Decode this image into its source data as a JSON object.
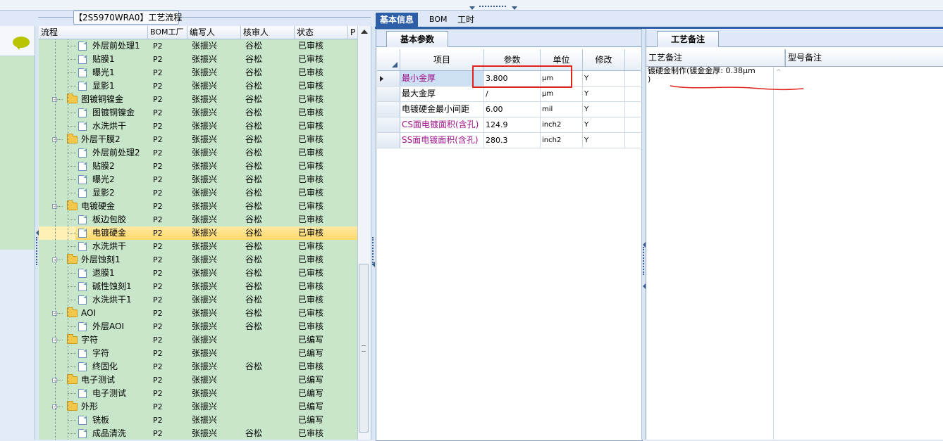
{
  "process_panel": {
    "caption": "【2S5970WRA0】工艺流程",
    "columns": [
      "流程",
      "BOM工厂",
      "编写人",
      "核审人",
      "状态",
      "P"
    ],
    "rows": [
      {
        "name": "外层前处理1",
        "level": 2,
        "type": "doc",
        "bom": "P2",
        "writer": "张振兴",
        "reviewer": "谷松",
        "status": "已审核"
      },
      {
        "name": "贴膜1",
        "level": 2,
        "type": "doc",
        "bom": "P2",
        "writer": "张振兴",
        "reviewer": "谷松",
        "status": "已审核"
      },
      {
        "name": "曝光1",
        "level": 2,
        "type": "doc",
        "bom": "P2",
        "writer": "张振兴",
        "reviewer": "谷松",
        "status": "已审核"
      },
      {
        "name": "显影1",
        "level": 2,
        "type": "doc",
        "bom": "P2",
        "writer": "张振兴",
        "reviewer": "谷松",
        "status": "已审核"
      },
      {
        "name": "图镀铜镍金",
        "level": 1,
        "type": "folder",
        "bom": "P2",
        "writer": "张振兴",
        "reviewer": "谷松",
        "status": "已审核"
      },
      {
        "name": "图镀铜镍金",
        "level": 2,
        "type": "doc",
        "bom": "P2",
        "writer": "张振兴",
        "reviewer": "谷松",
        "status": "已审核"
      },
      {
        "name": "水洗烘干",
        "level": 2,
        "type": "doc",
        "bom": "P2",
        "writer": "张振兴",
        "reviewer": "谷松",
        "status": "已审核"
      },
      {
        "name": "外层干膜2",
        "level": 1,
        "type": "folder",
        "bom": "P2",
        "writer": "张振兴",
        "reviewer": "谷松",
        "status": "已审核"
      },
      {
        "name": "外层前处理2",
        "level": 2,
        "type": "doc",
        "bom": "P2",
        "writer": "张振兴",
        "reviewer": "谷松",
        "status": "已审核"
      },
      {
        "name": "贴膜2",
        "level": 2,
        "type": "doc",
        "bom": "P2",
        "writer": "张振兴",
        "reviewer": "谷松",
        "status": "已审核"
      },
      {
        "name": "曝光2",
        "level": 2,
        "type": "doc",
        "bom": "P2",
        "writer": "张振兴",
        "reviewer": "谷松",
        "status": "已审核"
      },
      {
        "name": "显影2",
        "level": 2,
        "type": "doc",
        "bom": "P2",
        "writer": "张振兴",
        "reviewer": "谷松",
        "status": "已审核"
      },
      {
        "name": "电镀硬金",
        "level": 1,
        "type": "folder",
        "bom": "P2",
        "writer": "张振兴",
        "reviewer": "谷松",
        "status": "已审核"
      },
      {
        "name": "板边包胶",
        "level": 2,
        "type": "doc",
        "bom": "P2",
        "writer": "张振兴",
        "reviewer": "谷松",
        "status": "已审核"
      },
      {
        "name": "电镀硬金",
        "level": 2,
        "type": "doc",
        "bom": "P2",
        "writer": "张振兴",
        "reviewer": "谷松",
        "status": "已审核",
        "selected": true
      },
      {
        "name": "水洗烘干",
        "level": 2,
        "type": "doc",
        "bom": "P2",
        "writer": "张振兴",
        "reviewer": "谷松",
        "status": "已审核"
      },
      {
        "name": "外层蚀刻1",
        "level": 1,
        "type": "folder",
        "bom": "P2",
        "writer": "张振兴",
        "reviewer": "谷松",
        "status": "已审核"
      },
      {
        "name": "退膜1",
        "level": 2,
        "type": "doc",
        "bom": "P2",
        "writer": "张振兴",
        "reviewer": "谷松",
        "status": "已审核"
      },
      {
        "name": "碱性蚀刻1",
        "level": 2,
        "type": "doc",
        "bom": "P2",
        "writer": "张振兴",
        "reviewer": "谷松",
        "status": "已审核"
      },
      {
        "name": "水洗烘干1",
        "level": 2,
        "type": "doc",
        "bom": "P2",
        "writer": "张振兴",
        "reviewer": "谷松",
        "status": "已审核"
      },
      {
        "name": "AOI",
        "level": 1,
        "type": "folder",
        "bom": "P2",
        "writer": "张振兴",
        "reviewer": "谷松",
        "status": "已审核"
      },
      {
        "name": "外层AOI",
        "level": 2,
        "type": "doc",
        "bom": "P2",
        "writer": "张振兴",
        "reviewer": "谷松",
        "status": "已审核"
      },
      {
        "name": "字符",
        "level": 1,
        "type": "folder",
        "bom": "P2",
        "writer": "张振兴",
        "reviewer": "",
        "status": "已编写"
      },
      {
        "name": "字符",
        "level": 2,
        "type": "doc",
        "bom": "P2",
        "writer": "张振兴",
        "reviewer": "",
        "status": "已编写"
      },
      {
        "name": "终固化",
        "level": 2,
        "type": "doc",
        "bom": "P2",
        "writer": "张振兴",
        "reviewer": "谷松",
        "status": "已审核"
      },
      {
        "name": "电子测试",
        "level": 1,
        "type": "folder",
        "bom": "P2",
        "writer": "张振兴",
        "reviewer": "",
        "status": "已编写"
      },
      {
        "name": "电子测试",
        "level": 2,
        "type": "doc",
        "bom": "P2",
        "writer": "张振兴",
        "reviewer": "",
        "status": "已编写"
      },
      {
        "name": "外形",
        "level": 1,
        "type": "folder",
        "bom": "P2",
        "writer": "张振兴",
        "reviewer": "",
        "status": "已编写"
      },
      {
        "name": "铣板",
        "level": 2,
        "type": "doc",
        "bom": "P2",
        "writer": "张振兴",
        "reviewer": "",
        "status": "已编写"
      },
      {
        "name": "成品清洗",
        "level": 2,
        "type": "doc",
        "bom": "P2",
        "writer": "张振兴",
        "reviewer": "谷松",
        "status": "已审核"
      }
    ]
  },
  "main_tabs": [
    "基本信息",
    "BOM",
    "工时"
  ],
  "params_panel": {
    "tab": "基本参数",
    "columns": [
      "项目",
      "参数",
      "单位",
      "修改"
    ],
    "rows": [
      {
        "item": "最小金厚",
        "value": "3.800",
        "unit": "μm",
        "modify": "Y",
        "highlight": true,
        "current": true
      },
      {
        "item": "最大金厚",
        "value": "/",
        "unit": "μm",
        "modify": "Y"
      },
      {
        "item": "电镀硬金最小间距",
        "value": "6.00",
        "unit": "mil",
        "modify": "Y"
      },
      {
        "item": "CS面电镀面积(含孔)",
        "value": "124.9",
        "unit": "inch2",
        "modify": "Y",
        "highlight": true
      },
      {
        "item": "SS面电镀面积(含孔)",
        "value": "280.3",
        "unit": "inch2",
        "modify": "Y",
        "highlight": true
      }
    ]
  },
  "notes_panel": {
    "tab": "工艺备注",
    "col_process": "工艺备注",
    "col_model": "型号备注",
    "process_note": "镀硬金制作(镀金金厚: 0.38μm\n)"
  },
  "colors": {
    "tree_bg": "#c8e6c9",
    "selected_row": "#ffd86a",
    "accent_tab": "#2d5fa8",
    "highlight_text": "#a0148c",
    "annotation_red": "#e2231a"
  }
}
